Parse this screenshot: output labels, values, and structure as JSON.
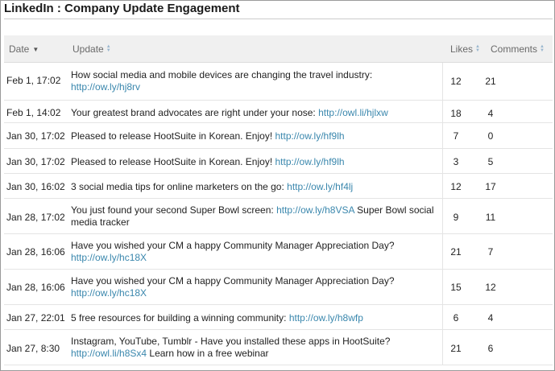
{
  "title": "LinkedIn : Company Update Engagement",
  "columns": {
    "date": "Date",
    "update": "Update",
    "likes": "Likes",
    "comments": "Comments"
  },
  "rows": [
    {
      "date": "Feb 1, 17:02",
      "text": "How social media and mobile devices are changing the travel industry:",
      "link": "http://ow.ly/hj8rv",
      "text_after": "",
      "likes": "12",
      "comments": "21"
    },
    {
      "date": "Feb 1, 14:02",
      "text": "Your greatest brand advocates are right under your nose:",
      "link": "http://owl.li/hjlxw",
      "text_after": "",
      "likes": "18",
      "comments": "4"
    },
    {
      "date": "Jan 30, 17:02",
      "text": "Pleased to release HootSuite in Korean. Enjoy!",
      "link": "http://ow.ly/hf9lh",
      "text_after": "",
      "likes": "7",
      "comments": "0"
    },
    {
      "date": "Jan 30, 17:02",
      "text": "Pleased to release HootSuite in Korean. Enjoy!",
      "link": "http://ow.ly/hf9lh",
      "text_after": "",
      "likes": "3",
      "comments": "5"
    },
    {
      "date": "Jan 30, 16:02",
      "text": "3 social media tips for online marketers on the go:",
      "link": "http://ow.ly/hf4lj",
      "text_after": "",
      "likes": "12",
      "comments": "17"
    },
    {
      "date": "Jan 28, 17:02",
      "text": "You just found your second Super Bowl screen:",
      "link": "http://ow.ly/h8VSA",
      "text_after": "Super Bowl social media tracker",
      "likes": "9",
      "comments": "11"
    },
    {
      "date": "Jan 28, 16:06",
      "text": "Have you wished your CM a happy Community Manager Appreciation Day?",
      "link": "http://ow.ly/hc18X",
      "text_after": "",
      "likes": "21",
      "comments": "7"
    },
    {
      "date": "Jan 28, 16:06",
      "text": "Have you wished your CM a happy Community Manager Appreciation Day?",
      "link": "http://ow.ly/hc18X",
      "text_after": "",
      "likes": "15",
      "comments": "12"
    },
    {
      "date": "Jan 27, 22:01",
      "text": "5 free resources for building a winning community:",
      "link": "http://ow.ly/h8wfp",
      "text_after": "",
      "likes": "6",
      "comments": "4"
    },
    {
      "date": "Jan 27, 8:30",
      "text": "Instagram, YouTube, Tumblr - Have you installed these apps in HootSuite?",
      "link": "http://owl.li/h8Sx4",
      "text_after": "Learn how in a free webinar",
      "likes": "21",
      "comments": "6"
    }
  ],
  "colors": {
    "link": "#3a87ad",
    "header_bg": "#f0f0f0",
    "sort_icon": "#9ab7cf"
  }
}
